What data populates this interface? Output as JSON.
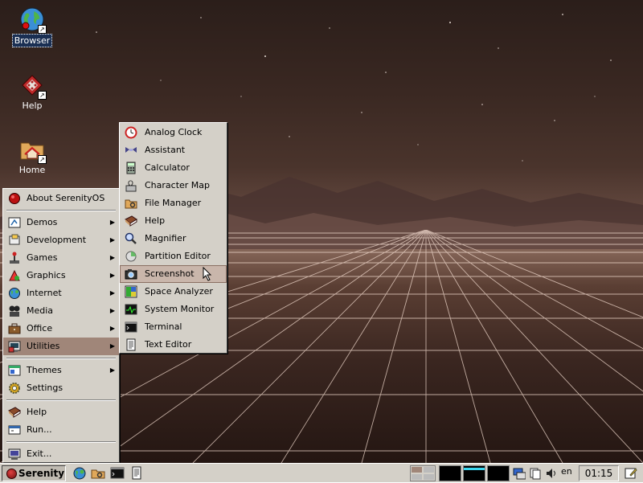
{
  "desktop": {
    "icons": [
      {
        "label": "Browser",
        "icon": "globe-icon",
        "selected": true
      },
      {
        "label": "Help",
        "icon": "help-book-icon",
        "selected": false
      },
      {
        "label": "Home",
        "icon": "home-folder-icon",
        "selected": false
      }
    ]
  },
  "start_menu": {
    "items": [
      {
        "label": "About SerenityOS",
        "icon": "serenity-logo-icon",
        "submenu": false
      },
      {
        "label": "Demos",
        "icon": "demos-icon",
        "submenu": true
      },
      {
        "label": "Development",
        "icon": "development-icon",
        "submenu": true
      },
      {
        "label": "Games",
        "icon": "joystick-icon",
        "submenu": true
      },
      {
        "label": "Graphics",
        "icon": "graphics-icon",
        "submenu": true
      },
      {
        "label": "Internet",
        "icon": "internet-icon",
        "submenu": true
      },
      {
        "label": "Media",
        "icon": "media-icon",
        "submenu": true
      },
      {
        "label": "Office",
        "icon": "briefcase-icon",
        "submenu": true
      },
      {
        "label": "Utilities",
        "icon": "utilities-icon",
        "submenu": true,
        "active": true
      },
      {
        "label": "Themes",
        "icon": "themes-icon",
        "submenu": true
      },
      {
        "label": "Settings",
        "icon": "settings-gear-icon",
        "submenu": false
      },
      {
        "label": "Help",
        "icon": "help-book-icon",
        "submenu": false
      },
      {
        "label": "Run...",
        "icon": "run-icon",
        "submenu": false
      },
      {
        "label": "Exit...",
        "icon": "exit-icon",
        "submenu": false
      }
    ]
  },
  "utilities_menu": {
    "items": [
      {
        "label": "Analog Clock",
        "icon": "clock-icon"
      },
      {
        "label": "Assistant",
        "icon": "assistant-icon"
      },
      {
        "label": "Calculator",
        "icon": "calculator-icon"
      },
      {
        "label": "Character Map",
        "icon": "character-map-icon"
      },
      {
        "label": "File Manager",
        "icon": "file-manager-icon"
      },
      {
        "label": "Help",
        "icon": "help-book-icon"
      },
      {
        "label": "Magnifier",
        "icon": "magnifier-icon"
      },
      {
        "label": "Partition Editor",
        "icon": "partition-editor-icon"
      },
      {
        "label": "Screenshot",
        "icon": "camera-icon",
        "hovered": true
      },
      {
        "label": "Space Analyzer",
        "icon": "space-analyzer-icon"
      },
      {
        "label": "System Monitor",
        "icon": "system-monitor-icon"
      },
      {
        "label": "Terminal",
        "icon": "terminal-icon"
      },
      {
        "label": "Text Editor",
        "icon": "text-editor-icon"
      }
    ]
  },
  "taskbar": {
    "start_label": "Serenity",
    "clock": "01:15",
    "language": "en",
    "colors": {
      "accent": "#b49b8e",
      "face": "#d4d0c8"
    }
  }
}
